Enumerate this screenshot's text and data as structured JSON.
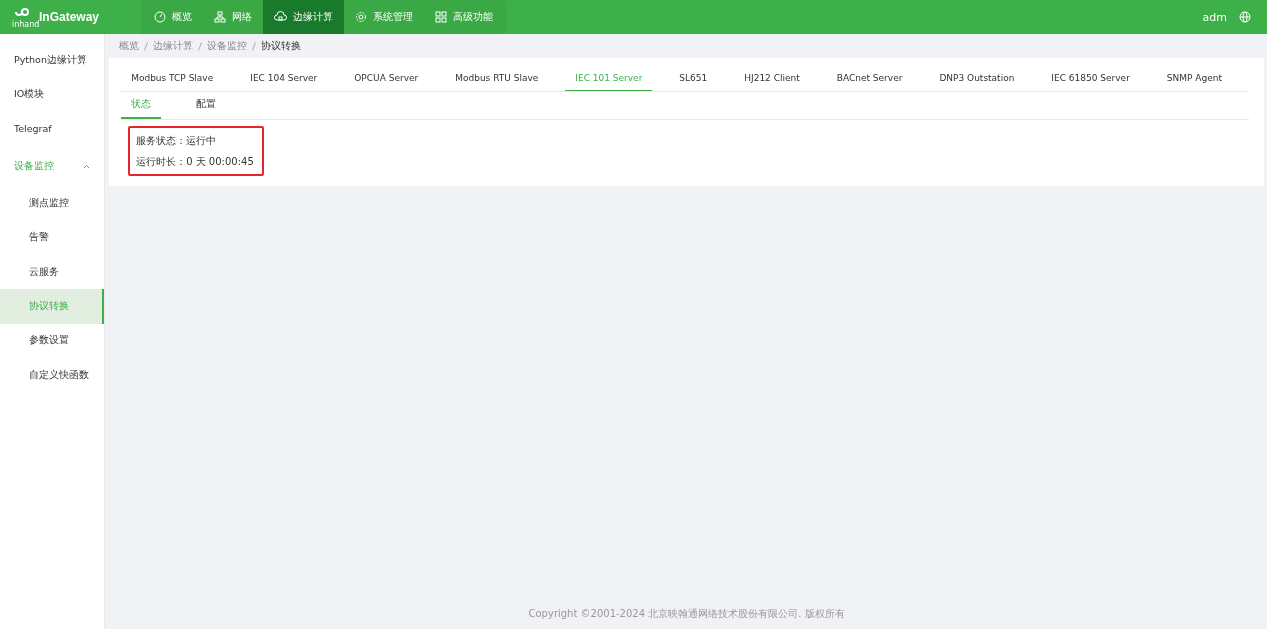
{
  "header": {
    "logo_small": "inhand",
    "logo": "InGateway",
    "nav": [
      {
        "label": "概览",
        "selected": false
      },
      {
        "label": "网络",
        "selected": false
      },
      {
        "label": "边缘计算",
        "selected": true
      },
      {
        "label": "系统管理",
        "selected": false
      },
      {
        "label": "高级功能",
        "selected": false
      }
    ],
    "user": "adm"
  },
  "sidebar": {
    "items": [
      {
        "label": "Python边缘计算",
        "selected": false
      },
      {
        "label": "IO模块",
        "selected": false
      },
      {
        "label": "Telegraf",
        "selected": false
      },
      {
        "label": "设备监控",
        "selected": false,
        "expanded": true,
        "children": [
          {
            "label": "测点监控",
            "selected": false
          },
          {
            "label": "告警",
            "selected": false
          },
          {
            "label": "云服务",
            "selected": false
          },
          {
            "label": "协议转换",
            "selected": true
          },
          {
            "label": "参数设置",
            "selected": false
          },
          {
            "label": "自定义快函数",
            "selected": false
          }
        ]
      }
    ]
  },
  "breadcrumb": [
    "概览",
    "边缘计算",
    "设备监控",
    "协议转换"
  ],
  "tabs": [
    {
      "label": "Modbus TCP Slave",
      "selected": false
    },
    {
      "label": "IEC 104 Server",
      "selected": false
    },
    {
      "label": "OPCUA Server",
      "selected": false
    },
    {
      "label": "Modbus RTU Slave",
      "selected": false
    },
    {
      "label": "IEC 101 Server",
      "selected": true
    },
    {
      "label": "SL651",
      "selected": false
    },
    {
      "label": "HJ212 Client",
      "selected": false
    },
    {
      "label": "BACnet Server",
      "selected": false
    },
    {
      "label": "DNP3 Outstation",
      "selected": false
    },
    {
      "label": "IEC 61850 Server",
      "selected": false
    },
    {
      "label": "SNMP Agent",
      "selected": false
    }
  ],
  "subtabs": [
    {
      "label": "状态",
      "selected": true
    },
    {
      "label": "配置",
      "selected": false
    }
  ],
  "status": [
    {
      "label": "服务状态：",
      "value": "运行中"
    },
    {
      "label": "运行时长：",
      "value": "0 天 00:00:45"
    }
  ],
  "footer": "Copyright ©2001-2024 北京映翰通网络技术股份有限公司. 版权所有"
}
